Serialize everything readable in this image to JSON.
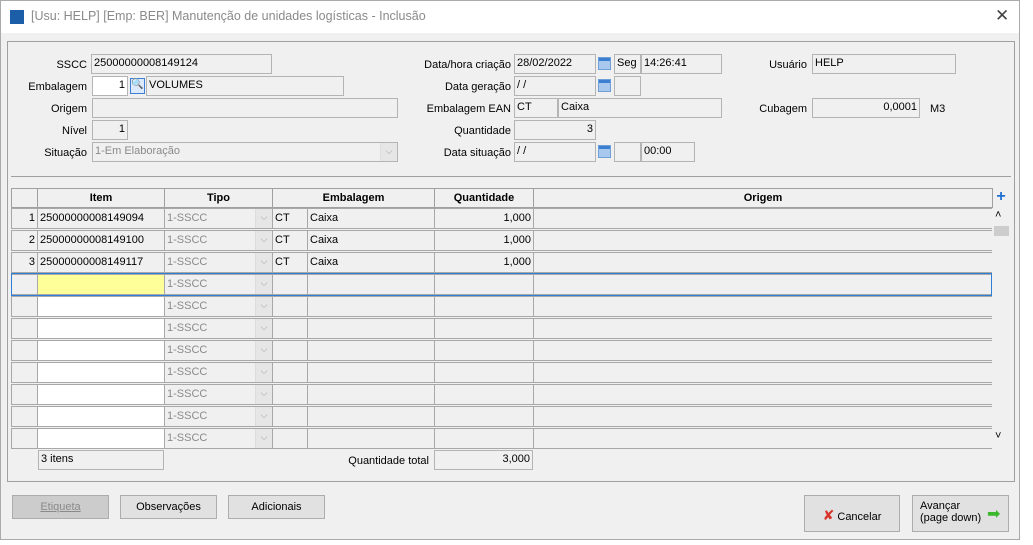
{
  "window": {
    "title": "[Usu: HELP] [Emp: BER] Manutenção de unidades logísticas - Inclusão"
  },
  "form": {
    "sscc_label": "SSCC",
    "sscc": "25000000008149124",
    "embalagem_label": "Embalagem",
    "embalagem_code": "1",
    "embalagem_desc": "VOLUMES",
    "origem_label": "Origem",
    "origem": "",
    "nivel_label": "Nível",
    "nivel": "1",
    "situacao_label": "Situação",
    "situacao": "1-Em Elaboração",
    "criacao_label": "Data/hora criação",
    "criacao_date": "28/02/2022",
    "criacao_dow": "Seg",
    "criacao_time": "14:26:41",
    "geracao_label": "Data geração",
    "geracao_date": " /  /",
    "geracao_dow": "",
    "ean_label": "Embalagem EAN",
    "ean_code": "CT",
    "ean_desc": "Caixa",
    "quantidade_label": "Quantidade",
    "quantidade": "3",
    "dsituacao_label": "Data situação",
    "dsituacao_date": " /  /",
    "dsituacao_dow": "",
    "dsituacao_time": "00:00",
    "usuario_label": "Usuário",
    "usuario": "HELP",
    "cubagem_label": "Cubagem",
    "cubagem": "0,0001",
    "cubagem_unit": "M3"
  },
  "grid": {
    "headers": [
      "Item",
      "Tipo",
      "Embalagem",
      "Quantidade",
      "Origem"
    ],
    "rows": [
      {
        "n": "1",
        "item": "25000000008149094",
        "tipo": "1-SSCC",
        "emb": "CT",
        "emb_desc": "Caixa",
        "qtd": "1,000",
        "origem": ""
      },
      {
        "n": "2",
        "item": "25000000008149100",
        "tipo": "1-SSCC",
        "emb": "CT",
        "emb_desc": "Caixa",
        "qtd": "1,000",
        "origem": ""
      },
      {
        "n": "3",
        "item": "25000000008149117",
        "tipo": "1-SSCC",
        "emb": "CT",
        "emb_desc": "Caixa",
        "qtd": "1,000",
        "origem": ""
      },
      {
        "n": "",
        "item": "",
        "tipo": "1-SSCC",
        "emb": "",
        "emb_desc": "",
        "qtd": "",
        "origem": ""
      },
      {
        "n": "",
        "item": "",
        "tipo": "1-SSCC",
        "emb": "",
        "emb_desc": "",
        "qtd": "",
        "origem": ""
      },
      {
        "n": "",
        "item": "",
        "tipo": "1-SSCC",
        "emb": "",
        "emb_desc": "",
        "qtd": "",
        "origem": ""
      },
      {
        "n": "",
        "item": "",
        "tipo": "1-SSCC",
        "emb": "",
        "emb_desc": "",
        "qtd": "",
        "origem": ""
      },
      {
        "n": "",
        "item": "",
        "tipo": "1-SSCC",
        "emb": "",
        "emb_desc": "",
        "qtd": "",
        "origem": ""
      },
      {
        "n": "",
        "item": "",
        "tipo": "1-SSCC",
        "emb": "",
        "emb_desc": "",
        "qtd": "",
        "origem": ""
      },
      {
        "n": "",
        "item": "",
        "tipo": "1-SSCC",
        "emb": "",
        "emb_desc": "",
        "qtd": "",
        "origem": ""
      },
      {
        "n": "",
        "item": "",
        "tipo": "1-SSCC",
        "emb": "",
        "emb_desc": "",
        "qtd": "",
        "origem": ""
      }
    ],
    "count": "3 itens",
    "total_label": "Quantidade total",
    "total": "3,000"
  },
  "buttons": {
    "etiqueta": "Etiqueta",
    "observacoes": "Observações",
    "adicionais": "Adicionais",
    "cancelar": "Cancelar",
    "avancar1": "Avançar",
    "avancar2": "(page down)"
  }
}
